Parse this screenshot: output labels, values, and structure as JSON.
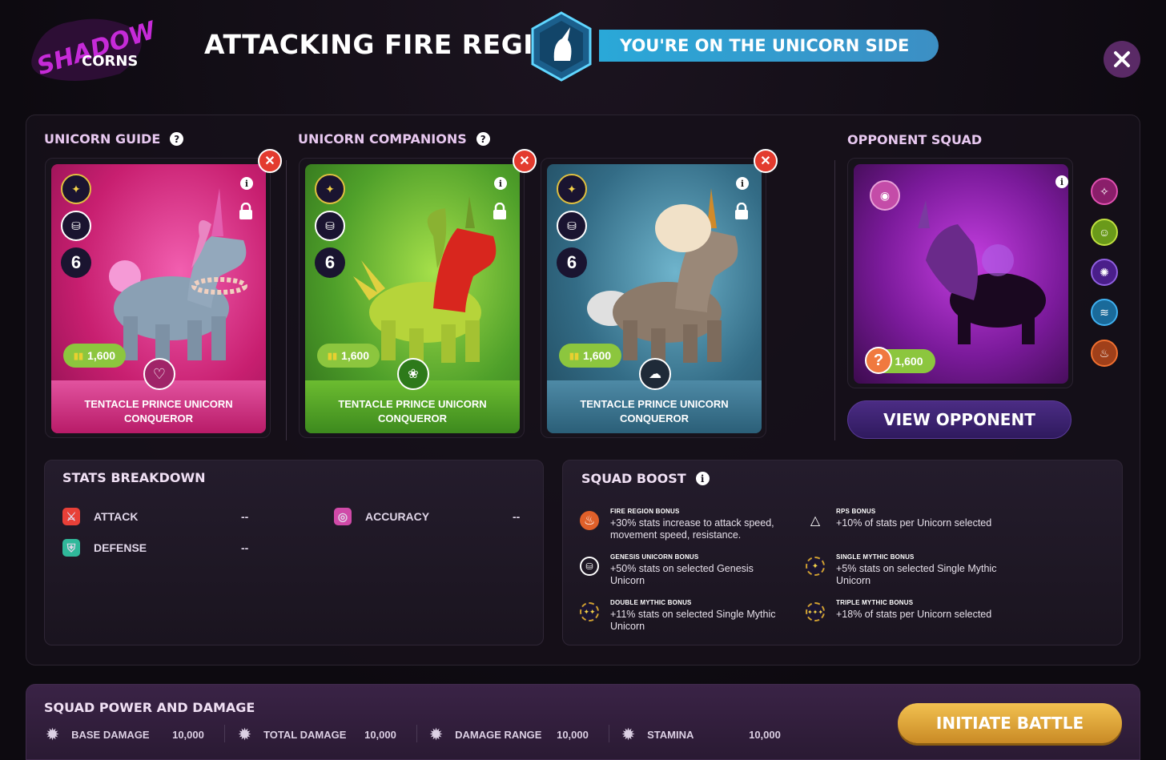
{
  "header": {
    "logo_text_1": "SHADOW",
    "logo_text_2": "CORNS",
    "title": "ATTACKING FIRE REGION",
    "side_banner": "YOU'RE ON THE UNICORN SIDE"
  },
  "sections": {
    "guide_title": "UNICORN GUIDE",
    "companions_title": "UNICORN COMPANIONS",
    "opponent_title": "OPPONENT SQUAD",
    "help": "?"
  },
  "cards": [
    {
      "name_line1": "TENTACLE PRINCE UNICORN",
      "name_line2": "CONQUEROR",
      "level": "6",
      "power": "1,600",
      "theme": "pink",
      "type_icon": "heart-icon"
    },
    {
      "name_line1": "TENTACLE PRINCE UNICORN",
      "name_line2": "CONQUEROR",
      "level": "6",
      "power": "1,600",
      "theme": "green",
      "type_icon": "plant-icon"
    },
    {
      "name_line1": "TENTACLE PRINCE UNICORN",
      "name_line2": "CONQUEROR",
      "level": "6",
      "power": "1,600",
      "theme": "blue",
      "type_icon": "storm-icon"
    }
  ],
  "opponent": {
    "power": "1,600",
    "unknown": "?",
    "view_button": "VIEW OPPONENT",
    "side_icons": [
      "fairy-icon",
      "frog-icon",
      "spider-icon",
      "water-icon",
      "fire-icon"
    ]
  },
  "stats": {
    "title": "STATS BREAKDOWN",
    "attack_label": "ATTACK",
    "attack_value": "--",
    "defense_label": "DEFENSE",
    "defense_value": "--",
    "accuracy_label": "ACCURACY",
    "accuracy_value": "--"
  },
  "boost": {
    "title": "SQUAD BOOST",
    "items": [
      {
        "name": "FIRE REGION BONUS",
        "desc": "+30% stats increase to attack speed, movement speed, resistance."
      },
      {
        "name": "RPS BONUS",
        "desc": "+10% of stats per Unicorn selected"
      },
      {
        "name": "GENESIS UNICORN BONUS",
        "desc": "+50% stats on selected Genesis Unicorn"
      },
      {
        "name": "SINGLE MYTHIC BONUS",
        "desc": "+5% stats on selected Single Mythic Unicorn"
      },
      {
        "name": "DOUBLE MYTHIC BONUS",
        "desc": "+11% stats on selected Single Mythic Unicorn"
      },
      {
        "name": "TRIPLE MYTHIC BONUS",
        "desc": "+18% of stats per Unicorn selected"
      }
    ]
  },
  "squad_power": {
    "title": "SQUAD POWER AND DAMAGE",
    "base_damage_label": "BASE DAMAGE",
    "base_damage": "10,000",
    "total_damage_label": "TOTAL DAMAGE",
    "total_damage": "10,000",
    "damage_range_label": "DAMAGE RANGE",
    "damage_range": "10,000",
    "stamina_label": "STAMINA",
    "stamina": "10,000",
    "battle_button": "INITIATE BATTLE"
  },
  "colors": {
    "pink": "#d8287e",
    "green": "#6ab42e",
    "blue": "#3f7d9a",
    "remove": "#e33b2e",
    "power": "#8cc63e",
    "battle": "#e0a53a",
    "banner": "#2aa8d8"
  }
}
